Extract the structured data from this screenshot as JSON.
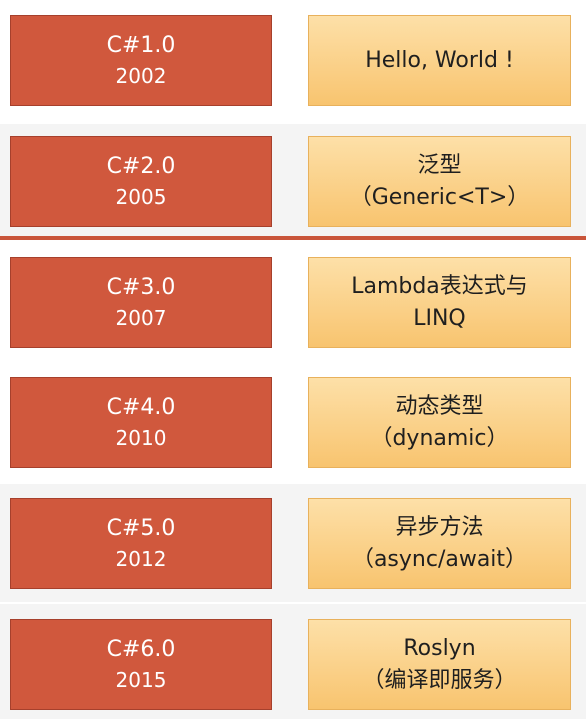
{
  "colors": {
    "version_box": "#d0583d",
    "feature_box_top": "#fde0a8",
    "feature_box_bottom": "#f8c46f",
    "divider": "#c9553a"
  },
  "rows": [
    {
      "version": "C#1.0",
      "year": "2002",
      "feature_lines": [
        "Hello, World !"
      ]
    },
    {
      "version": "C#2.0",
      "year": "2005",
      "feature_lines": [
        "泛型",
        "（Generic<T>）"
      ]
    },
    {
      "version": "C#3.0",
      "year": "2007",
      "feature_lines": [
        "Lambda表达式与",
        "LINQ"
      ]
    },
    {
      "version": "C#4.0",
      "year": "2010",
      "feature_lines": [
        "动态类型",
        "（dynamic）"
      ]
    },
    {
      "version": "C#5.0",
      "year": "2012",
      "feature_lines": [
        "异步方法",
        "（async/await）"
      ]
    },
    {
      "version": "C#6.0",
      "year": "2015",
      "feature_lines": [
        "Roslyn",
        "（编译即服务）"
      ]
    }
  ]
}
